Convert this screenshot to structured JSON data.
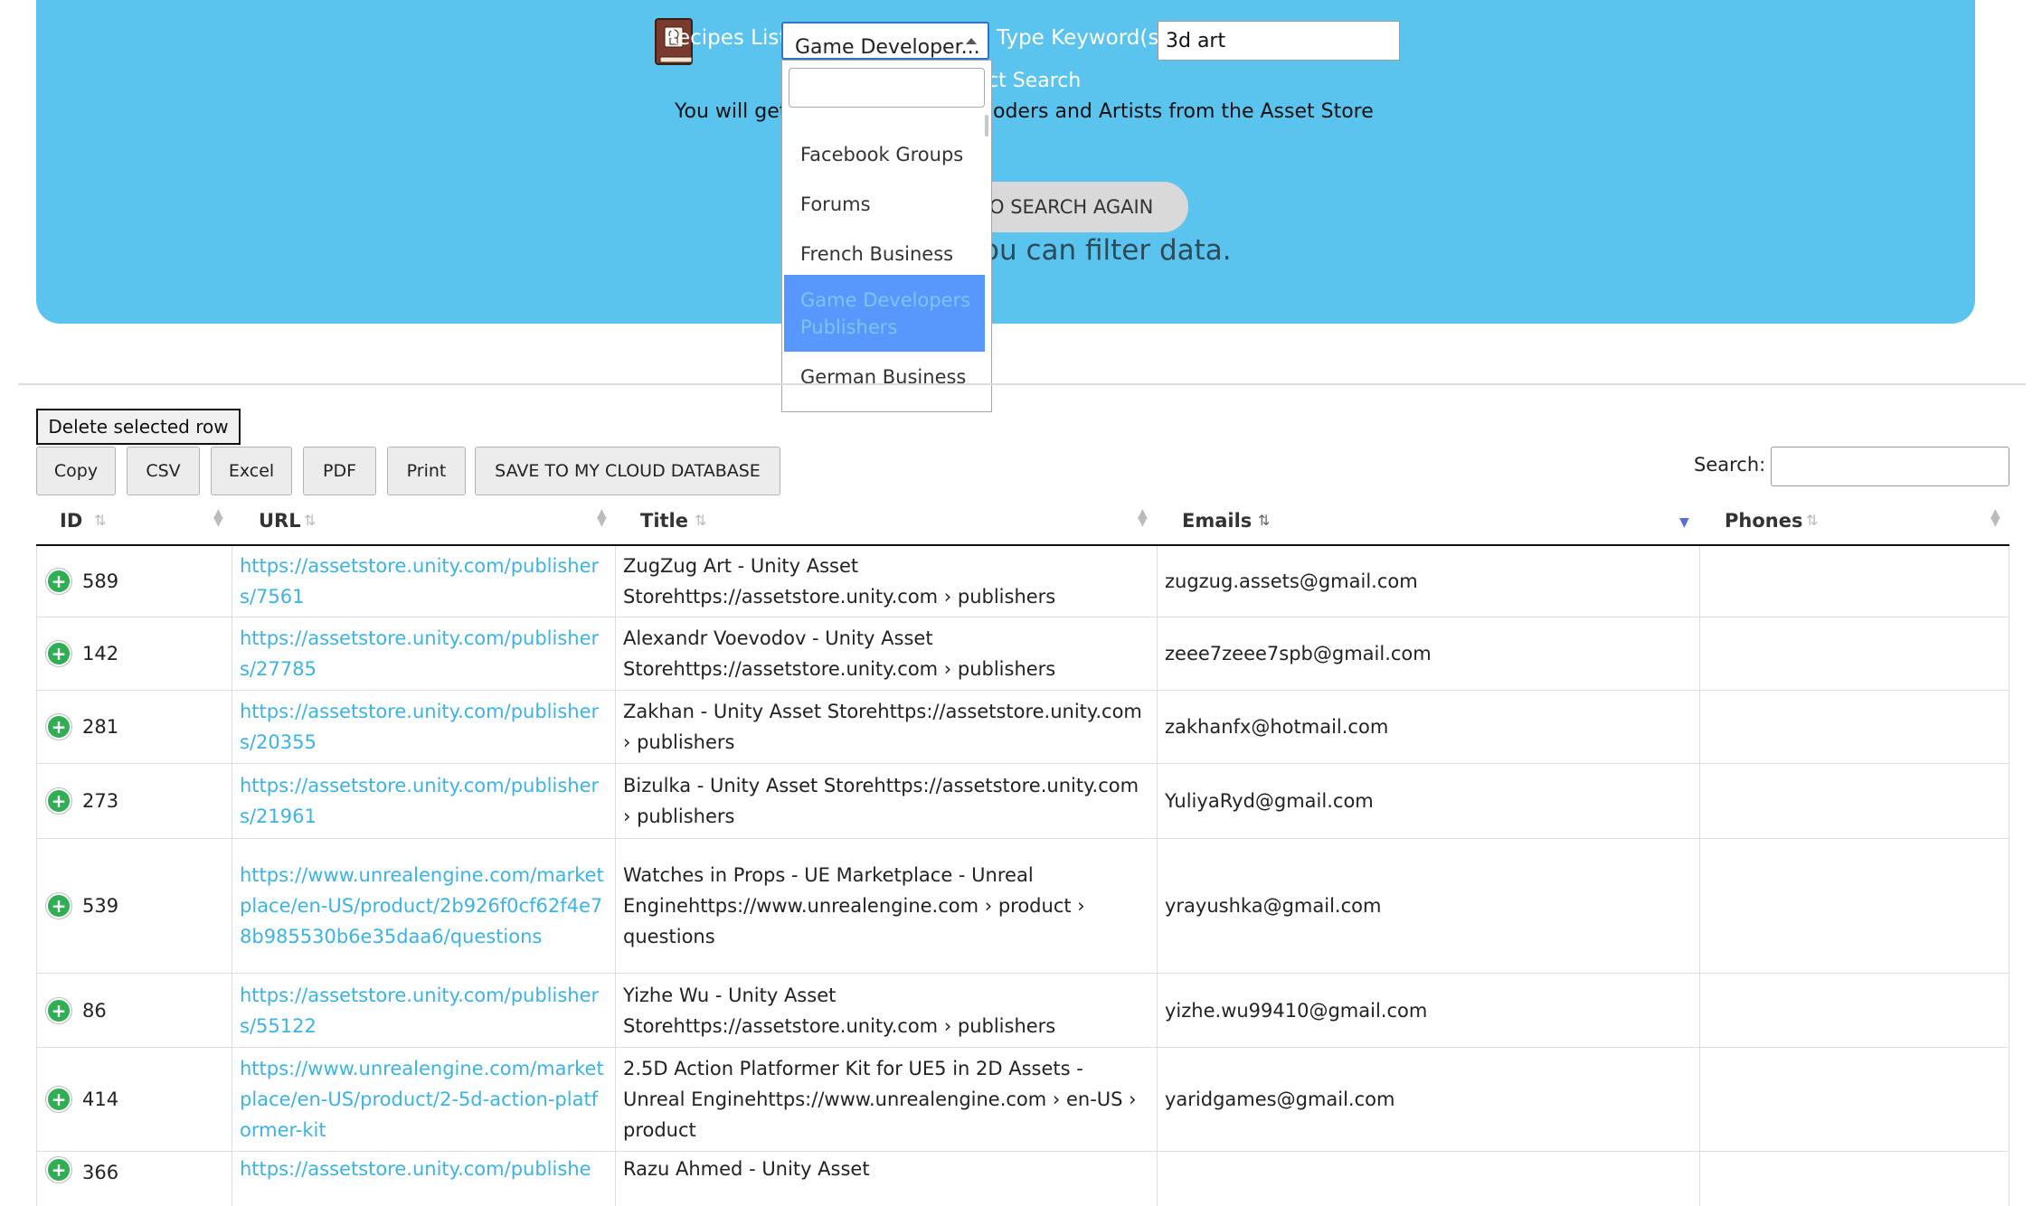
{
  "header": {
    "recipes_label": "Recipes List:",
    "selected_recipe": "Game Developer...",
    "keyword_label": "Type Keyword(s):",
    "keyword_value": "3d art",
    "search_link": "ct Search",
    "info_left": "You will get",
    "info_right": "oders and Artists from the Asset Store",
    "search_again": "O SEARCH AGAIN",
    "filter_text": "ou can filter data."
  },
  "dropdown": {
    "search_value": "",
    "items": [
      "Facebook Groups",
      "Forums",
      "French Business",
      "Game Developers Publishers",
      "German Business"
    ],
    "selected_index": 3
  },
  "toolbar": {
    "delete_row": "Delete selected row",
    "buttons": [
      "Copy",
      "CSV",
      "Excel",
      "PDF",
      "Print",
      "SAVE TO MY CLOUD DATABASE"
    ],
    "search_label": "Search:",
    "search_value": ""
  },
  "table": {
    "columns": [
      "ID",
      "URL",
      "Title",
      "Emails",
      "Phones"
    ],
    "sorted_column": "Emails",
    "sort_direction": "descending",
    "rows": [
      {
        "id": "589",
        "url": "https://assetstore.unity.com/publishers/7561",
        "title": "ZugZug Art - Unity Asset Storehttps://assetstore.unity.com › publishers",
        "email": "zugzug.assets@gmail.com",
        "phone": ""
      },
      {
        "id": "142",
        "url": "https://assetstore.unity.com/publishers/27785",
        "title": "Alexandr Voevodov - Unity Asset Storehttps://assetstore.unity.com › publishers",
        "email": "zeee7zeee7spb@gmail.com",
        "phone": ""
      },
      {
        "id": "281",
        "url": "https://assetstore.unity.com/publishers/20355",
        "title": "Zakhan - Unity Asset Storehttps://assetstore.unity.com › publishers",
        "email": "zakhanfx@hotmail.com",
        "phone": ""
      },
      {
        "id": "273",
        "url": "https://assetstore.unity.com/publishers/21961",
        "title": "Bizulka - Unity Asset Storehttps://assetstore.unity.com › publishers",
        "email": "YuliyaRyd@gmail.com",
        "phone": ""
      },
      {
        "id": "539",
        "url": "https://www.unrealengine.com/marketplace/en-US/product/2b926f0cf62f4e78b985530b6e35daa6/questions",
        "title": "Watches in Props - UE Marketplace - Unreal Enginehttps://www.unrealengine.com › product › questions",
        "email": "yrayushka@gmail.com",
        "phone": ""
      },
      {
        "id": "86",
        "url": "https://assetstore.unity.com/publishers/55122",
        "title": "Yizhe Wu - Unity Asset Storehttps://assetstore.unity.com › publishers",
        "email": "yizhe.wu99410@gmail.com",
        "phone": ""
      },
      {
        "id": "414",
        "url": "https://www.unrealengine.com/marketplace/en-US/product/2-5d-action-platformer-kit",
        "title": "2.5D Action Platformer Kit for UE5 in 2D Assets - Unreal Enginehttps://www.unrealengine.com › en-US › product",
        "email": "yaridgames@gmail.com",
        "phone": ""
      },
      {
        "id": "366",
        "url": "https://assetstore.unity.com/publishe",
        "title": "Razu Ahmed - Unity Asset",
        "email": "",
        "phone": ""
      }
    ]
  }
}
